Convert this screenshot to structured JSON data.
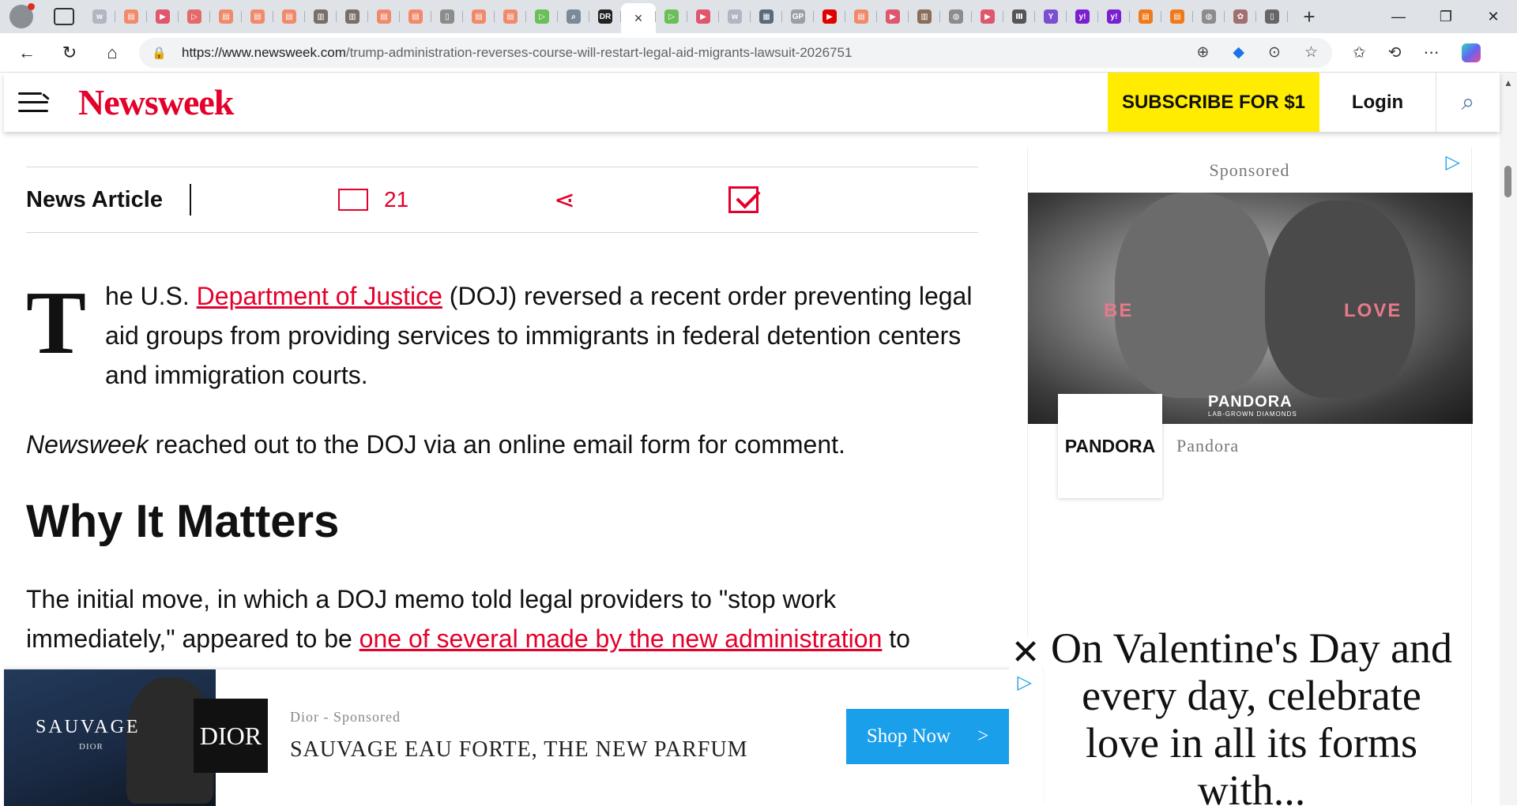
{
  "browser": {
    "tabs": [
      {
        "color": "#b0b7c3",
        "glyph": "w"
      },
      {
        "color": "#f08a6a",
        "glyph": "▤"
      },
      {
        "color": "#e0566d",
        "glyph": "▶"
      },
      {
        "color": "#e46a6a",
        "glyph": "▷"
      },
      {
        "color": "#f08a6a",
        "glyph": "▤"
      },
      {
        "color": "#f08a6a",
        "glyph": "▤"
      },
      {
        "color": "#f08a6a",
        "glyph": "▤"
      },
      {
        "color": "#7a6e66",
        "glyph": "▥"
      },
      {
        "color": "#7a6e66",
        "glyph": "▥"
      },
      {
        "color": "#f08a6a",
        "glyph": "▤"
      },
      {
        "color": "#f08a6a",
        "glyph": "▤"
      },
      {
        "color": "#8c8c8c",
        "glyph": "▯"
      },
      {
        "color": "#f08a6a",
        "glyph": "▤"
      },
      {
        "color": "#f08a6a",
        "glyph": "▤"
      },
      {
        "color": "#6bbf59",
        "glyph": "▷"
      },
      {
        "color": "#7a8a99",
        "glyph": "⌕"
      },
      {
        "color": "#222222",
        "glyph": "DR"
      }
    ],
    "tabs_after": [
      {
        "color": "#6bbf59",
        "glyph": "▷"
      },
      {
        "color": "#e0566d",
        "glyph": "▶"
      },
      {
        "color": "#b0b7c3",
        "glyph": "w"
      },
      {
        "color": "#5a6a7a",
        "glyph": "▦"
      },
      {
        "color": "#9aa0a6",
        "glyph": "GP"
      },
      {
        "color": "#e00000",
        "glyph": "▶"
      },
      {
        "color": "#f08a6a",
        "glyph": "▤"
      },
      {
        "color": "#e0566d",
        "glyph": "▶"
      },
      {
        "color": "#8a6e5a",
        "glyph": "▥"
      },
      {
        "color": "#8c8c8c",
        "glyph": "◍"
      },
      {
        "color": "#e0566d",
        "glyph": "▶"
      },
      {
        "color": "#555555",
        "glyph": "Ⅲ"
      },
      {
        "color": "#7b4fd1",
        "glyph": "Y"
      },
      {
        "color": "#7b1fd1",
        "glyph": "y!"
      },
      {
        "color": "#7b1fd1",
        "glyph": "y!"
      },
      {
        "color": "#f07a1a",
        "glyph": "▤"
      },
      {
        "color": "#f07a1a",
        "glyph": "▤"
      },
      {
        "color": "#8c8c8c",
        "glyph": "◍"
      },
      {
        "color": "#a07070",
        "glyph": "✿"
      },
      {
        "color": "#666666",
        "glyph": "▯"
      }
    ],
    "active_tab_close": "×",
    "new_tab": "+",
    "minimize": "—",
    "restore": "❐",
    "close": "✕",
    "url_host": "https://www.newsweek.com",
    "url_path": "/trump-administration-reverses-course-will-restart-legal-aid-migrants-lawsuit-2026751"
  },
  "site": {
    "logo": "Newsweek",
    "subscribe_label": "SUBSCRIBE FOR $1",
    "login_label": "Login",
    "brand_color": "#e4002b",
    "subscribe_color": "#ffec00"
  },
  "article": {
    "type_label": "News Article",
    "comment_count": "21",
    "dropcap": "T",
    "p1_before": "he U.S. ",
    "p1_link": "Department of Justice",
    "p1_after": " (DOJ) reversed a recent order preventing legal aid groups from providing services to immigrants in federal detention centers and immigration courts.",
    "p2_italic": "Newsweek",
    "p2_rest": " reached out to the DOJ via an online email form for comment.",
    "h2": "Why It Matters",
    "p3_before": "The initial move, in which a DOJ memo told legal providers to \"stop work immediately,\" appeared to be ",
    "p3_link": "one of several made by the new administration",
    "p3_after": " to"
  },
  "rail_ad": {
    "sponsored_label": "Sponsored",
    "image_text_left": "BE",
    "image_text_right": "LOVE",
    "image_brand": "PANDORA",
    "image_tagline": "LAB-GROWN DIAMONDS",
    "brand_logo": "PANDORA",
    "brand_name": "Pandora",
    "headline": "On Valentine's Day and every day, celebrate love in all its forms with..."
  },
  "bottom_ad": {
    "image_title": "SAUVAGE",
    "image_brand": "DIOR",
    "logo": "DIOR",
    "sponsor_line": "Dior - Sponsored",
    "title": "SAUVAGE EAU FORTE, THE NEW PARFUM",
    "cta_label": "Shop Now",
    "cta_arrow": ">",
    "cta_color": "#1a9fea",
    "close_label": "✕"
  }
}
